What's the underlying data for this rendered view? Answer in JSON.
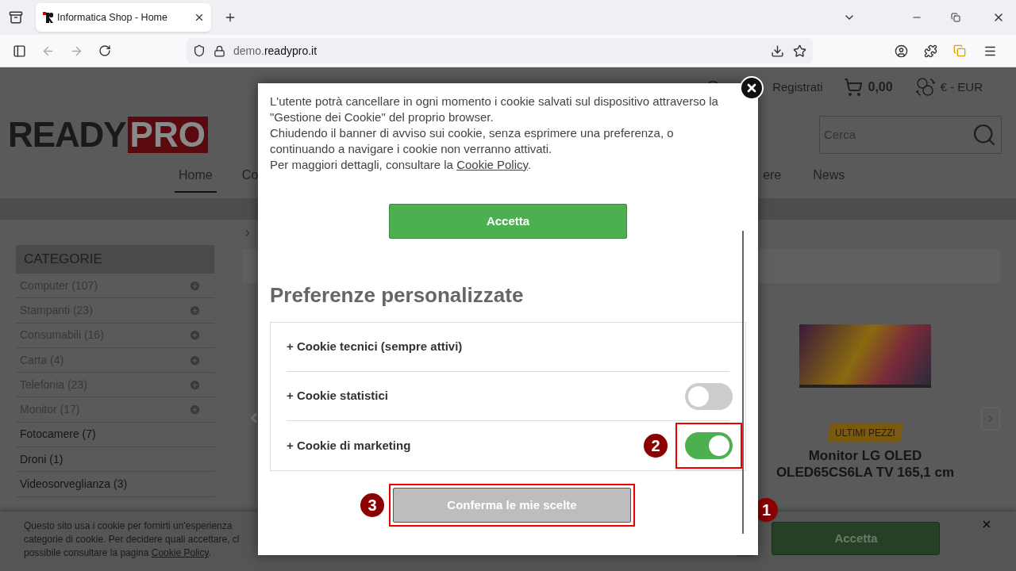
{
  "browser": {
    "tab": {
      "title": "Informatica Shop - Home",
      "selected": true
    },
    "url": {
      "host_prefix": "demo.",
      "host_domain": "readypro.it"
    }
  },
  "header": {
    "register": "Registrati",
    "cart_total": "0,00",
    "currency": "€ - EUR",
    "logo": {
      "word": "READY",
      "box": "PRO"
    },
    "search": {
      "placeholder": "Cerca"
    },
    "nav": [
      {
        "label": "Home",
        "selected": true
      },
      {
        "label": "Co",
        "selected": false
      },
      {
        "label": "ere",
        "selected": false
      },
      {
        "label": "News",
        "selected": false
      }
    ]
  },
  "sidebar": {
    "title": "CATEGORIE",
    "items": [
      {
        "label": "Computer (107)",
        "expandable": true
      },
      {
        "label": "Stampanti (23)",
        "expandable": true
      },
      {
        "label": "Consumabili (16)",
        "expandable": true
      },
      {
        "label": "Carta (4)",
        "expandable": true
      },
      {
        "label": "Telefonia (23)",
        "expandable": true
      },
      {
        "label": "Monitor (17)",
        "expandable": true
      },
      {
        "label": "Fotocamere (7)",
        "expandable": false
      },
      {
        "label": "Droni (1)",
        "expandable": false
      },
      {
        "label": "Videosorveglianza (3)",
        "expandable": false
      }
    ]
  },
  "product": {
    "badge": "ULTIMI PEZZI",
    "title": "Monitor LG OLED OLED65CS6LA TV 165,1 cm"
  },
  "cookie_banner": {
    "lines": [
      "Questo sito usa i cookie per fornirti un'esperienza",
      "categorie di cookie. Per decidere quali accettare, cl"
    ],
    "last_line": "possibile consultare la pagina ",
    "link": "Cookie Policy",
    "link_after": ".",
    "accept": "Accetta",
    "accept_badge": "1"
  },
  "modal": {
    "paragraphs": [
      "L'utente potrà cancellare in ogni momento i cookie salvati sul dispositivo attraverso la \"Gestione dei Cookie\" del proprio browser.",
      "Chiudendo il banner di avviso sui cookie, senza esprimere una preferenza, o continuando a navigare i cookie non verranno attivati."
    ],
    "policy_text": "Per maggiori dettagli, consultare la ",
    "policy_link": "Cookie Policy",
    "policy_after": ".",
    "accept": "Accetta",
    "heading": "Preferenze personalizzate",
    "preferences": [
      {
        "kind": "fixed",
        "label": "+ Cookie tecnici (sempre attivi)"
      },
      {
        "kind": "toggle",
        "label": "+ Cookie statistici",
        "on": false,
        "highlighted": false
      },
      {
        "kind": "toggle",
        "label": "+ Cookie di marketing",
        "on": true,
        "highlighted": true,
        "badge": "2"
      }
    ],
    "confirm": {
      "label": "Conferma le mie scelte",
      "highlighted": true,
      "badge": "3"
    }
  }
}
